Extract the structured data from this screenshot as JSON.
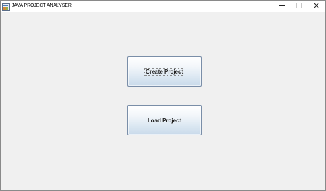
{
  "window": {
    "title": "JAVA PROJECT ANALYSER",
    "controls": {
      "minimize_icon": "minimize-icon",
      "maximize_icon": "maximize-icon",
      "close_icon": "close-icon"
    }
  },
  "buttons": {
    "create_label": "Create Project",
    "load_label": "Load Project"
  },
  "colors": {
    "background": "#f0f0f0",
    "button_border": "#7a8ea8",
    "button_gradient_bottom": "#c9daea"
  }
}
